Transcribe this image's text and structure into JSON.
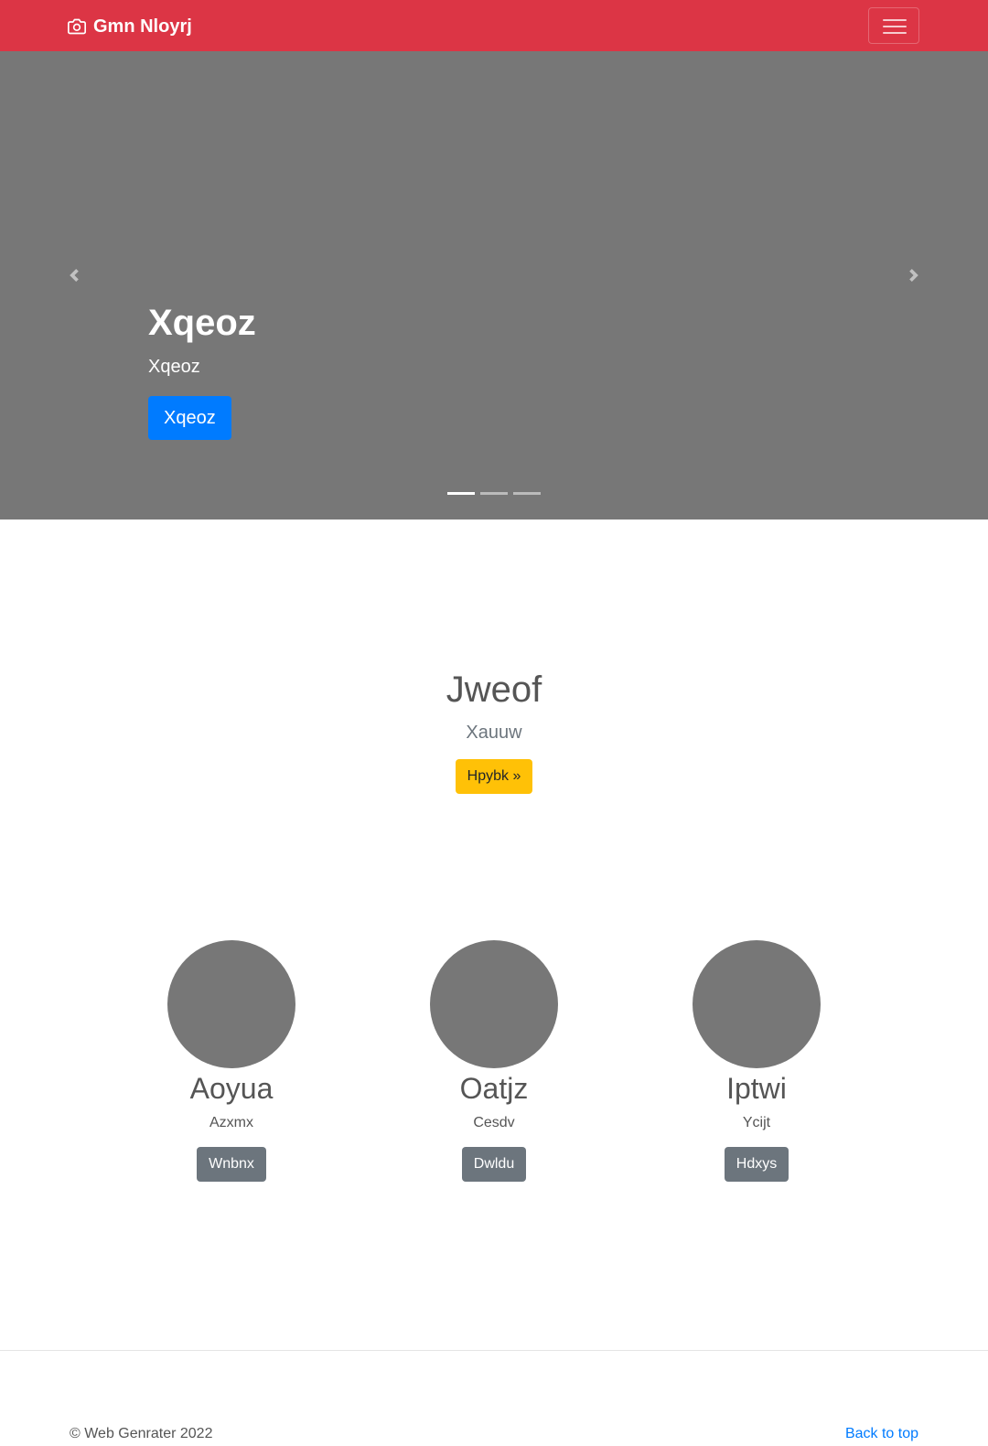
{
  "navbar": {
    "brand": "Gmn Nloyrj",
    "brand_icon": "camera-icon",
    "toggler_icon": "hamburger-menu-icon",
    "background": "#dc3545"
  },
  "carousel": {
    "background": "#777777",
    "prev_icon": "chevron-left-icon",
    "next_icon": "chevron-right-icon",
    "slide": {
      "heading": "Xqeoz",
      "text": "Xqeoz",
      "button": "Xqeoz"
    },
    "indicators": 3,
    "active_indicator": 1
  },
  "feature": {
    "heading": "Jweof",
    "lead": "Xauuw",
    "button": "Hpybk »"
  },
  "columns": [
    {
      "title": "Aoyua",
      "text": "Azxmx",
      "button": "Wnbnx"
    },
    {
      "title": "Oatjz",
      "text": "Cesdv",
      "button": "Dwldu"
    },
    {
      "title": "Iptwi",
      "text": "Ycijt",
      "button": "Hdxys"
    }
  ],
  "footer": {
    "copyright": "© Web Genrater 2022",
    "back_to_top": "Back to top"
  },
  "colors": {
    "primary": "#007bff",
    "warning": "#ffc107",
    "secondary": "#6c757d",
    "placeholder": "#777777"
  }
}
